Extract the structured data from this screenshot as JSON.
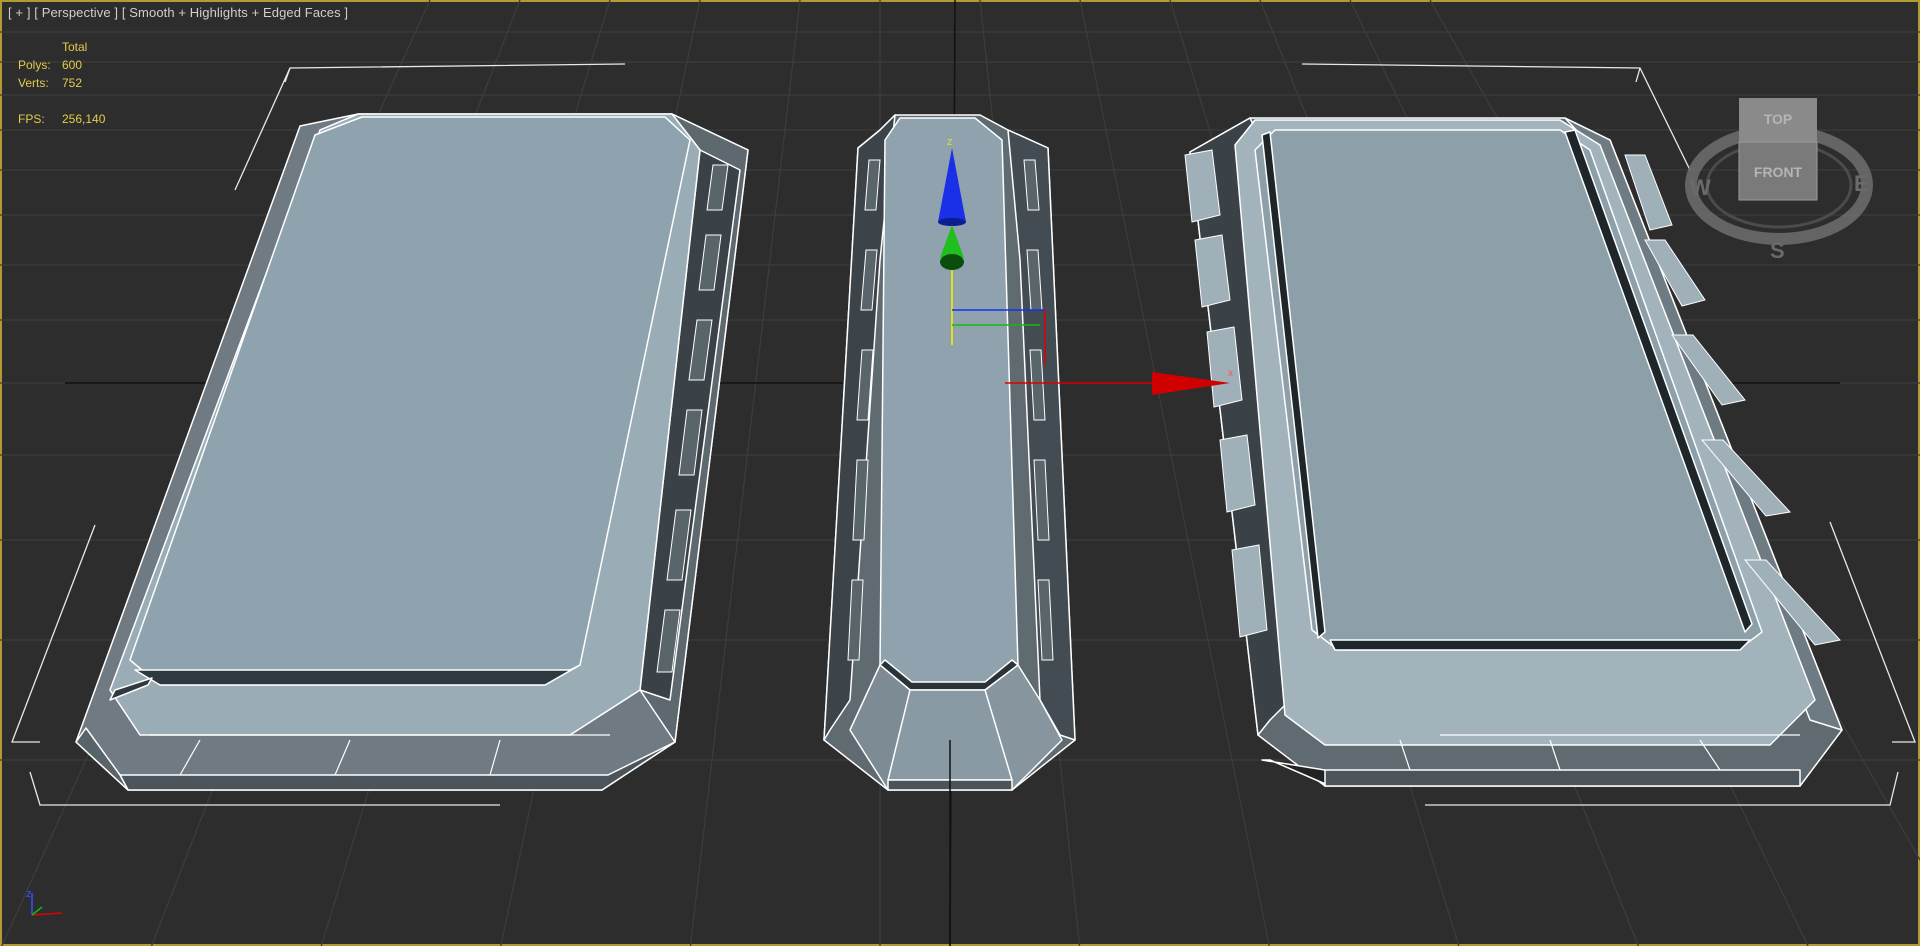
{
  "viewport": {
    "label_parts": [
      "[ + ]",
      "[ Perspective ]",
      "[ Smooth + Highlights + Edged Faces ]"
    ]
  },
  "stats": {
    "header": "Total",
    "polys_label": "Polys:",
    "polys_value": "600",
    "verts_label": "Verts:",
    "verts_value": "752",
    "fps_label": "FPS:",
    "fps_value": "256,140"
  },
  "viewcube": {
    "top": "TOP",
    "front": "FRONT",
    "west": "W",
    "east": "E",
    "south": "S"
  },
  "gizmo": {
    "z_label": "z",
    "x_label": "x"
  },
  "axis_tripod": {
    "z_label": "z"
  },
  "colors": {
    "viewport_bg": "#2d2d2d",
    "grid": "#3c3c3c",
    "world_axis": "#111111",
    "stats_text": "#e3cc4a",
    "model_face": "#8c9faa",
    "edge": "#ffffff",
    "gizmo_x": "#e00000",
    "gizmo_y": "#11bb11",
    "gizmo_z": "#1133ee",
    "border": "#b39b34"
  }
}
